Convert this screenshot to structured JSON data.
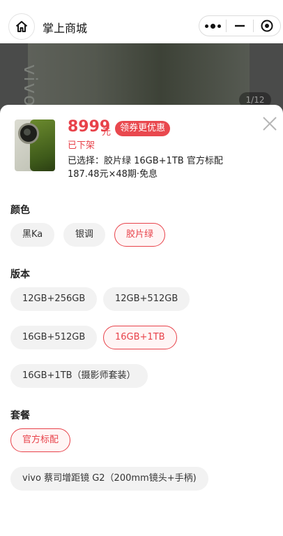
{
  "nav": {
    "title": "掌上商城",
    "home_icon": "home-icon",
    "more_icon": "more-icon",
    "minimize_icon": "minimize-icon",
    "close_icon": "record-circle-icon"
  },
  "hero": {
    "brand_text": "vivo",
    "page_indicator": "1/12"
  },
  "product": {
    "price": "8999",
    "price_unit": "元",
    "coupon_label": "领券更优惠",
    "status": "已下架",
    "selected_text": "已选择：胶片绿 16GB+1TB 官方标配",
    "installment_text": "187.48元×48期·免息"
  },
  "options": {
    "color": {
      "title": "颜色",
      "items": [
        "黑Ka",
        "银调",
        "胶片绿"
      ],
      "selected": "胶片绿"
    },
    "version": {
      "title": "版本",
      "items": [
        "12GB+256GB",
        "12GB+512GB",
        "16GB+512GB",
        "16GB+1TB",
        "16GB+1TB（摄影师套装）"
      ],
      "selected": "16GB+1TB"
    },
    "package": {
      "title": "套餐",
      "items": [
        "官方标配",
        "vivo 蔡司增距镜 G2（200mm镜头+手柄)"
      ],
      "selected": "官方标配"
    }
  },
  "colors": {
    "accent": "#e8424a",
    "chip_bg": "#f2f2f2"
  }
}
